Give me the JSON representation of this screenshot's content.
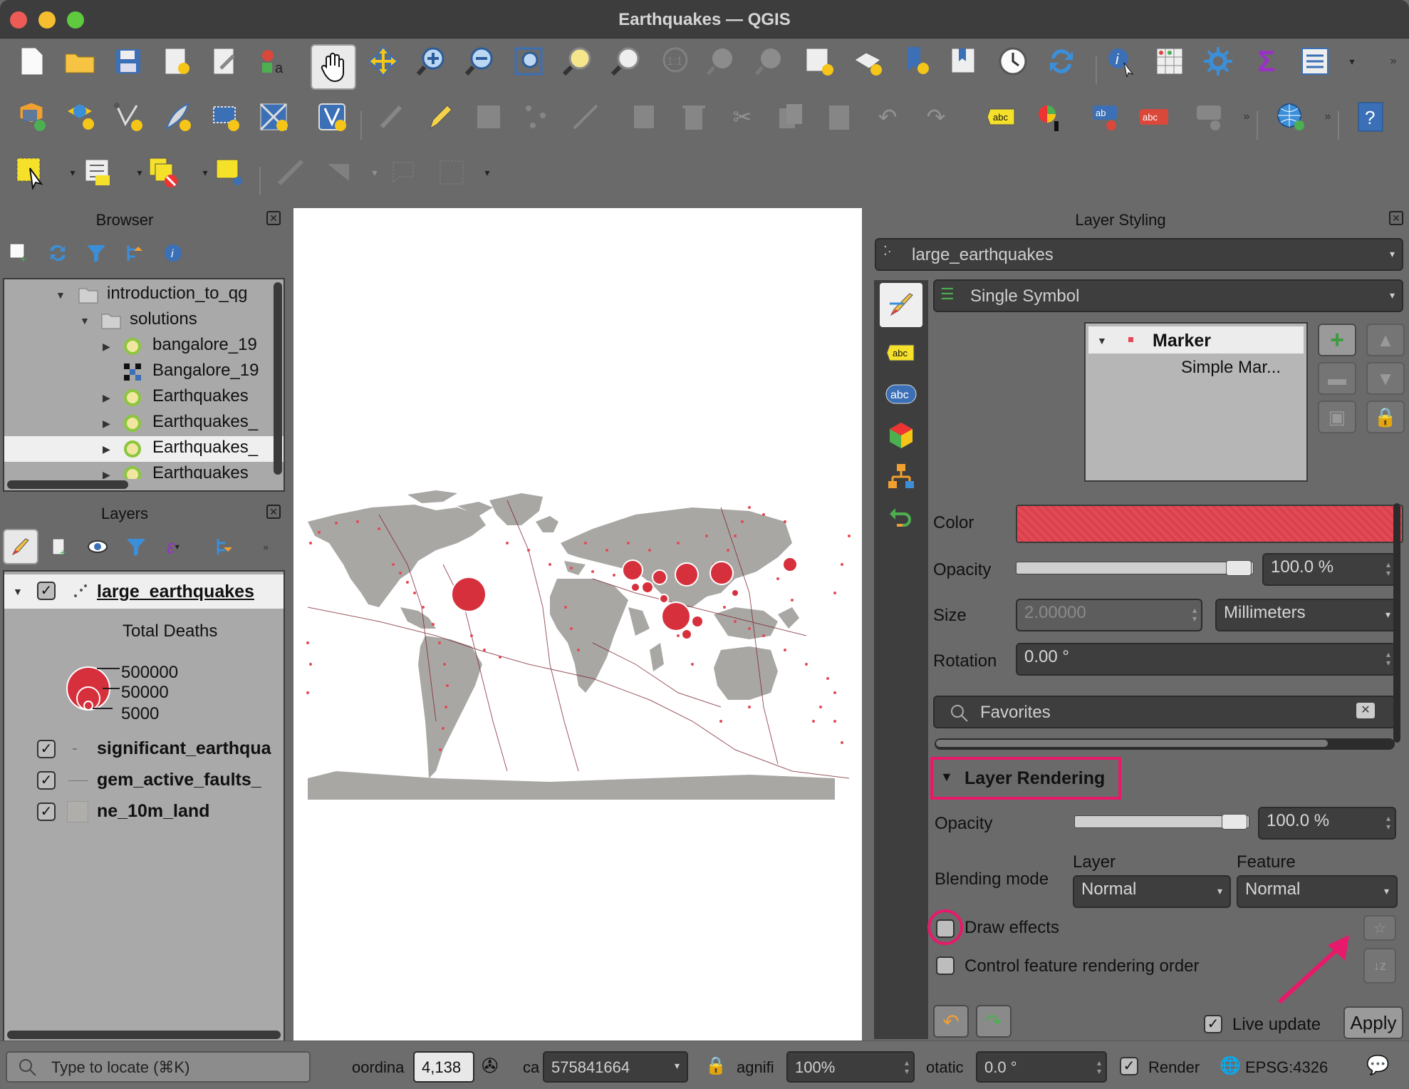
{
  "window": {
    "title": "Earthquakes — QGIS"
  },
  "browser": {
    "title": "Browser",
    "items": [
      {
        "label": "introduction_to_qg"
      },
      {
        "label": "solutions"
      },
      {
        "label": "bangalore_19"
      },
      {
        "label": "Bangalore_19"
      },
      {
        "label": "Earthquakes"
      },
      {
        "label": "Earthquakes_"
      },
      {
        "label": "Earthquakes_"
      },
      {
        "label": "Earthquakes"
      }
    ]
  },
  "layers": {
    "title": "Layers",
    "items": [
      {
        "label": "large_earthquakes",
        "checked": true
      },
      {
        "label": "significant_earthqua",
        "checked": true
      },
      {
        "label": "gem_active_faults_",
        "checked": true
      },
      {
        "label": "ne_10m_land",
        "checked": true
      }
    ],
    "legend": {
      "title": "Total Deaths",
      "values": [
        "500000",
        "50000",
        "5000"
      ]
    }
  },
  "styling": {
    "title": "Layer Styling",
    "layer_select": "large_earthquakes",
    "renderer": "Single Symbol",
    "symbol_tree": {
      "root": "Marker",
      "child": "Simple Mar..."
    },
    "color_label": "Color",
    "color_value": "#e34a55",
    "opacity_label": "Opacity",
    "opacity_value": "100.0 %",
    "size_label": "Size",
    "size_value": "2.00000",
    "size_unit": "Millimeters",
    "rotation_label": "Rotation",
    "rotation_value": "0.00 °",
    "search_placeholder": "Favorites",
    "rendering": {
      "header": "Layer Rendering",
      "opacity_label": "Opacity",
      "opacity_value": "100.0 %",
      "blending_label": "Blending mode",
      "layer_col": "Layer",
      "feature_col": "Feature",
      "layer_blend": "Normal",
      "feature_blend": "Normal",
      "draw_effects": "Draw effects",
      "control_order": "Control feature rendering order"
    },
    "live_update": "Live update",
    "apply": "Apply"
  },
  "statusbar": {
    "locate_placeholder": "Type to locate (⌘K)",
    "coordinate_label": "oordina",
    "coordinate_value": "4,138",
    "scale_label": "ca",
    "scale_value": "575841664",
    "magnifier_label": "agnifi",
    "magnifier_value": "100%",
    "rotation_label": "otatic",
    "rotation_value": "0.0 °",
    "render_label": "Render",
    "crs": "EPSG:4326"
  }
}
